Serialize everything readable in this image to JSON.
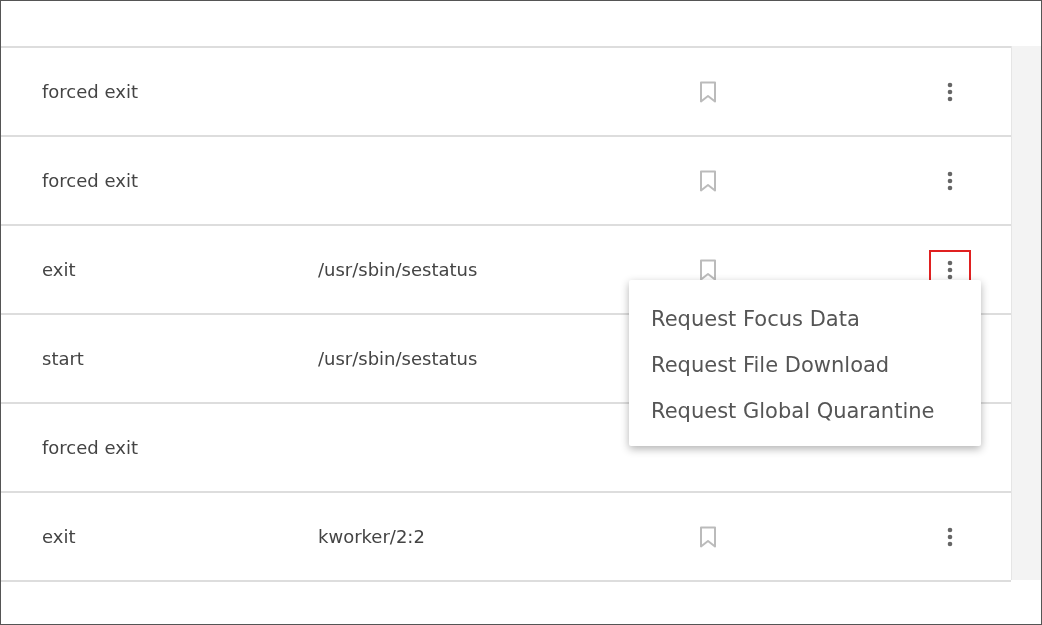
{
  "rows": [
    {
      "event": "forced exit",
      "path": "",
      "menu_open": false
    },
    {
      "event": "forced exit",
      "path": "",
      "menu_open": false
    },
    {
      "event": "exit",
      "path": "/usr/sbin/sestatus",
      "menu_open": true
    },
    {
      "event": "start",
      "path": "/usr/sbin/sestatus",
      "menu_open": false
    },
    {
      "event": "forced exit",
      "path": "",
      "menu_open": false
    },
    {
      "event": "exit",
      "path": "kworker/2:2",
      "menu_open": false
    }
  ],
  "menu": {
    "items": [
      "Request Focus Data",
      "Request File Download",
      "Request Global Quarantine"
    ]
  }
}
